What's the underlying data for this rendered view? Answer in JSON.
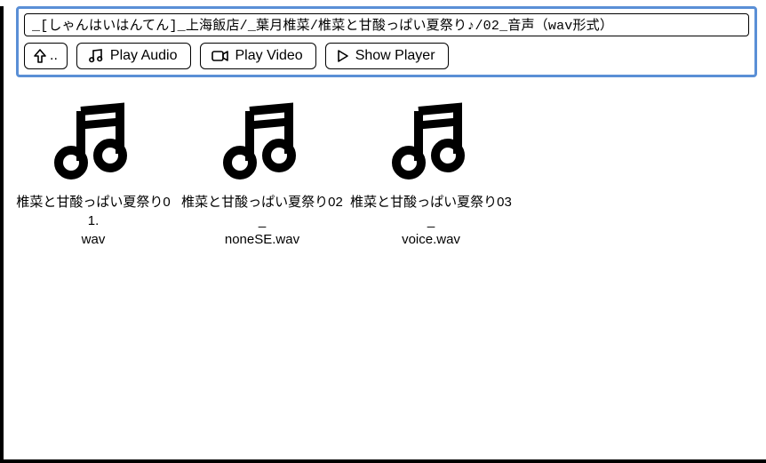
{
  "path": "_[しゃんはいはんてん]_上海飯店/_葉月椎菜/椎菜と甘酸っぱい夏祭り♪/02_音声（wav形式）",
  "toolbar": {
    "up_label": "..",
    "play_audio": "Play Audio",
    "play_video": "Play Video",
    "show_player": "Show Player"
  },
  "files": [
    {
      "name_line1": "椎菜と甘酸っぱい夏祭り01.",
      "name_line2": "wav"
    },
    {
      "name_line1": "椎菜と甘酸っぱい夏祭り02_",
      "name_line2": "noneSE.wav"
    },
    {
      "name_line1": "椎菜と甘酸っぱい夏祭り03_",
      "name_line2": "voice.wav"
    }
  ]
}
